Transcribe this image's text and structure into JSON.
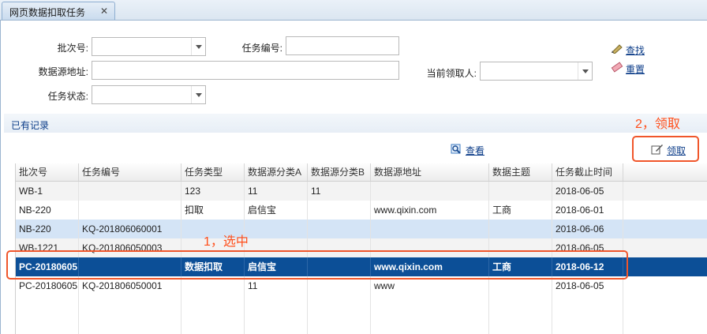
{
  "tab": {
    "title": "网页数据扣取任务",
    "close": "✕"
  },
  "filters": {
    "batch_no_label": "批次号:",
    "task_no_label": "任务编号:",
    "source_url_label": "数据源地址:",
    "current_claimant_label": "当前领取人:",
    "task_status_label": "任务状态:",
    "batch_no_value": "",
    "task_no_value": "",
    "source_url_value": "",
    "current_claimant_value": "",
    "task_status_value": ""
  },
  "actions": {
    "search": "查找",
    "reset": "重置",
    "view": "查看",
    "claim": "领取"
  },
  "section": {
    "title": "已有记录"
  },
  "annotations": {
    "step1": "1，选中",
    "step2": "2，领取"
  },
  "colors": {
    "selected_row": "#0c4f97",
    "annotation": "#ff4e1a",
    "link": "#0b3c88"
  },
  "grid": {
    "columns": [
      "批次号",
      "任务编号",
      "任务类型",
      "数据源分类A",
      "数据源分类B",
      "数据源地址",
      "数据主题",
      "任务截止时间"
    ],
    "rows": [
      [
        "WB-1",
        "",
        "123",
        "11",
        "11",
        "",
        "",
        "2018-06-05"
      ],
      [
        "NB-220",
        "",
        "扣取",
        "启信宝",
        "",
        "www.qixin.com",
        "工商",
        "2018-06-01"
      ],
      [
        "NB-220",
        "KQ-201806060001",
        "",
        "",
        "",
        "",
        "",
        "2018-06-06"
      ],
      [
        "WB-1221",
        "KQ-201806050003",
        "",
        "",
        "",
        "",
        "",
        "2018-06-05"
      ],
      [
        "PC-20180605",
        "",
        "数据扣取",
        "启信宝",
        "",
        "www.qixin.com",
        "工商",
        "2018-06-12"
      ],
      [
        "PC-20180605",
        "KQ-201806050001",
        "",
        "11",
        "",
        "www",
        "",
        "2018-06-05"
      ]
    ],
    "selected_row": 4,
    "hover_row": 2
  }
}
